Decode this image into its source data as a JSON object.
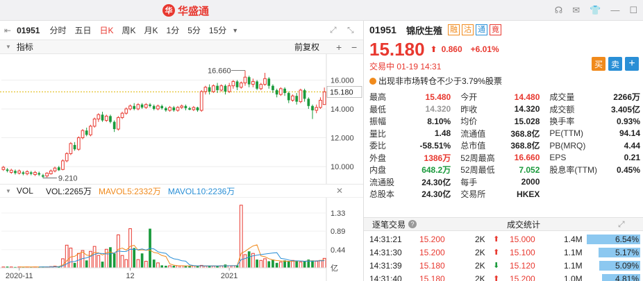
{
  "app": {
    "logo_mark": "华",
    "logo_text": "华盛通",
    "window_icons": [
      "headset-icon",
      "mail-icon",
      "shirt-icon",
      "minimize-icon",
      "maximize-icon"
    ]
  },
  "toolbar": {
    "code": "01951",
    "tabs": [
      "分时",
      "五日",
      "日K",
      "周K",
      "月K",
      "1分",
      "5分",
      "15分"
    ],
    "active_tab": 2
  },
  "indicator_bar": {
    "label": "指标",
    "adjust": "前复权"
  },
  "volume_bar": {
    "label": "VOL",
    "vol": "VOL:2265万",
    "ma5": "MAVOL5:2332万",
    "ma10": "MAVOL10:2236万"
  },
  "colors": {
    "up": "#e8382f",
    "down": "#1a9a3c",
    "ma5": "#f08a1c",
    "ma10": "#2a8fd6",
    "last_line": "#e0b600"
  },
  "chart_data": {
    "type": "candlestick",
    "price_axis": [
      "16.000",
      "14.000",
      "12.000",
      "10.000"
    ],
    "price_ylim": [
      8.9,
      17.7
    ],
    "last_label": "15.180",
    "last_price": 15.18,
    "high_label": "16.660",
    "low_label": "9.210",
    "vol_axis": [
      "1.33",
      "0.89",
      "0.44",
      "亿"
    ],
    "vol_ylim": [
      0,
      1.65
    ],
    "x_labels": [
      "2020-11",
      "12",
      "2021"
    ],
    "x_label_index": [
      4,
      32,
      57
    ],
    "candles": [
      [
        9.8,
        9.95,
        9.7,
        10.05
      ],
      [
        9.8,
        9.7,
        9.6,
        9.9
      ],
      [
        9.6,
        9.75,
        9.5,
        9.85
      ],
      [
        9.7,
        9.55,
        9.45,
        9.8
      ],
      [
        9.55,
        9.7,
        9.45,
        9.8
      ],
      [
        9.6,
        9.5,
        9.4,
        9.7
      ],
      [
        9.5,
        9.65,
        9.4,
        9.75
      ],
      [
        9.6,
        9.5,
        9.4,
        9.7
      ],
      [
        9.45,
        9.6,
        9.35,
        9.7
      ],
      [
        9.55,
        9.45,
        9.35,
        9.65
      ],
      [
        9.4,
        9.3,
        9.21,
        9.5
      ],
      [
        9.35,
        9.55,
        9.25,
        9.6
      ],
      [
        9.5,
        9.7,
        9.45,
        9.8
      ],
      [
        9.7,
        9.9,
        9.6,
        10.0
      ],
      [
        9.95,
        9.75,
        9.7,
        10.05
      ],
      [
        9.8,
        10.4,
        9.75,
        10.5
      ],
      [
        10.4,
        10.9,
        10.3,
        11.0
      ],
      [
        10.9,
        11.6,
        10.8,
        11.7
      ],
      [
        11.5,
        11.2,
        11.1,
        11.7
      ],
      [
        11.2,
        12.0,
        11.1,
        12.1
      ],
      [
        12.0,
        12.5,
        11.9,
        12.6
      ],
      [
        12.5,
        12.2,
        12.1,
        12.7
      ],
      [
        12.2,
        12.8,
        12.1,
        12.9
      ],
      [
        12.8,
        13.3,
        12.7,
        13.4
      ],
      [
        13.3,
        13.6,
        13.1,
        13.7
      ],
      [
        13.6,
        13.2,
        13.1,
        13.8
      ],
      [
        13.2,
        13.5,
        13.1,
        13.6
      ],
      [
        13.5,
        13.1,
        13.0,
        13.6
      ],
      [
        13.1,
        12.6,
        12.4,
        13.2
      ],
      [
        12.6,
        13.4,
        12.5,
        13.5
      ],
      [
        13.4,
        13.7,
        13.3,
        13.8
      ],
      [
        13.7,
        14.0,
        13.6,
        14.1
      ],
      [
        14.0,
        14.2,
        13.9,
        14.3
      ],
      [
        14.2,
        14.0,
        13.9,
        14.4
      ],
      [
        14.0,
        14.3,
        13.9,
        14.4
      ],
      [
        14.3,
        14.1,
        14.0,
        14.4
      ],
      [
        14.1,
        14.3,
        14.0,
        14.4
      ],
      [
        14.3,
        14.2,
        14.1,
        14.4
      ],
      [
        14.2,
        14.0,
        13.9,
        14.3
      ],
      [
        14.0,
        14.2,
        13.9,
        14.3
      ],
      [
        14.2,
        14.05,
        13.95,
        14.3
      ],
      [
        14.05,
        13.9,
        13.8,
        14.15
      ],
      [
        13.9,
        14.1,
        13.8,
        14.2
      ],
      [
        14.1,
        13.9,
        13.8,
        14.2
      ],
      [
        13.9,
        14.1,
        13.8,
        14.2
      ],
      [
        14.1,
        14.2,
        14.0,
        14.3
      ],
      [
        14.2,
        14.05,
        13.9,
        14.3
      ],
      [
        14.05,
        13.95,
        13.9,
        14.15
      ],
      [
        13.95,
        14.1,
        13.85,
        14.2
      ],
      [
        14.1,
        13.9,
        13.8,
        14.15
      ],
      [
        13.9,
        15.2,
        13.8,
        15.3
      ],
      [
        15.2,
        15.5,
        15.0,
        15.6
      ],
      [
        15.5,
        15.2,
        15.0,
        15.7
      ],
      [
        15.2,
        15.6,
        15.1,
        15.7
      ],
      [
        15.6,
        15.3,
        15.1,
        15.8
      ],
      [
        15.3,
        15.6,
        15.2,
        15.7
      ],
      [
        15.6,
        15.2,
        15.0,
        15.7
      ],
      [
        15.2,
        15.6,
        15.1,
        15.8
      ],
      [
        15.6,
        15.9,
        15.4,
        16.0
      ],
      [
        15.9,
        15.5,
        15.3,
        16.0
      ],
      [
        15.5,
        15.8,
        15.4,
        15.9
      ],
      [
        15.8,
        16.2,
        15.6,
        16.66
      ],
      [
        16.2,
        15.7,
        15.5,
        16.3
      ],
      [
        15.7,
        15.9,
        15.5,
        16.1
      ],
      [
        15.9,
        15.4,
        15.3,
        16.0
      ],
      [
        15.4,
        15.7,
        15.3,
        15.8
      ],
      [
        15.7,
        16.1,
        15.6,
        16.5
      ],
      [
        16.1,
        15.6,
        15.4,
        16.2
      ],
      [
        15.6,
        15.3,
        15.1,
        15.7
      ],
      [
        15.3,
        15.0,
        14.8,
        15.4
      ],
      [
        15.0,
        15.4,
        14.9,
        15.5
      ],
      [
        15.4,
        15.1,
        14.9,
        15.5
      ],
      [
        15.1,
        14.6,
        14.4,
        15.2
      ],
      [
        14.6,
        14.9,
        14.5,
        15.0
      ],
      [
        14.9,
        14.5,
        14.3,
        15.1
      ],
      [
        14.5,
        15.3,
        14.4,
        15.4
      ],
      [
        15.3,
        14.7,
        14.5,
        15.4
      ],
      [
        14.7,
        14.2,
        14.0,
        14.8
      ],
      [
        14.2,
        13.9,
        13.3,
        14.3
      ],
      [
        13.9,
        14.1,
        13.7,
        14.3
      ],
      [
        14.1,
        14.6,
        14.0,
        14.8
      ],
      [
        14.3,
        15.18,
        14.32,
        15.48
      ]
    ],
    "volume": [
      0.02,
      0.03,
      0.02,
      0.02,
      0.02,
      0.02,
      0.02,
      0.02,
      0.02,
      0.02,
      0.03,
      0.02,
      0.03,
      0.04,
      0.03,
      0.22,
      0.55,
      0.48,
      0.12,
      0.35,
      0.42,
      0.18,
      0.4,
      0.52,
      0.3,
      0.15,
      0.45,
      0.5,
      0.35,
      0.8,
      0.3,
      0.2,
      0.95,
      0.48,
      0.2,
      0.35,
      0.16,
      0.95,
      0.2,
      0.12,
      0.06,
      0.05,
      0.05,
      0.05,
      0.05,
      0.05,
      0.04,
      0.04,
      0.05,
      0.04,
      0.06,
      0.04,
      0.05,
      0.04,
      0.04,
      0.05,
      0.08,
      0.05,
      0.05,
      0.06,
      1.52,
      0.32,
      0.4,
      0.35,
      0.2,
      0.18,
      0.22,
      0.16,
      0.2,
      0.12,
      0.14,
      0.18,
      0.16,
      0.18,
      0.16,
      0.14,
      0.16,
      0.2,
      0.18,
      0.16,
      0.18,
      0.23
    ]
  },
  "quote": {
    "code": "01951",
    "name": "锦欣生殖",
    "tags": [
      [
        "融",
        "#f08a1c"
      ],
      [
        "沽",
        "#f08a1c"
      ],
      [
        "通",
        "#2a8fd6"
      ],
      [
        "竟",
        "#e8382f"
      ]
    ],
    "price": "15.180",
    "change": "0.860",
    "pct": "+6.01%",
    "status": "交易中 01-19 14:31",
    "notice": "出现非市场转仓不少于3.79%股票",
    "buttons": {
      "buy": "买",
      "sell": "卖",
      "add": "+"
    },
    "rows": [
      [
        [
          "最高",
          "15.480",
          "red"
        ],
        [
          "今开",
          "14.480",
          "red"
        ],
        [
          "成交量",
          "2266万",
          ""
        ]
      ],
      [
        [
          "最低",
          "14.320",
          "gray"
        ],
        [
          "昨收",
          "14.320",
          ""
        ],
        [
          "成交额",
          "3.405亿",
          ""
        ]
      ],
      [
        [
          "振幅",
          "8.10%",
          ""
        ],
        [
          "均价",
          "15.028",
          ""
        ],
        [
          "换手率",
          "0.93%",
          ""
        ]
      ],
      [
        [
          "量比",
          "1.48",
          ""
        ],
        [
          "流通值",
          "368.8亿",
          ""
        ],
        [
          "PE(TTM)",
          "94.14",
          ""
        ]
      ],
      [
        [
          "委比",
          "-58.51%",
          ""
        ],
        [
          "总市值",
          "368.8亿",
          ""
        ],
        [
          "PB(MRQ)",
          "4.44",
          ""
        ]
      ],
      [
        [
          "外盘",
          "1386万",
          "red"
        ],
        [
          "52周最高",
          "16.660",
          "red"
        ],
        [
          "EPS",
          "0.21",
          ""
        ]
      ],
      [
        [
          "内盘",
          "648.2万",
          "green"
        ],
        [
          "52周最低",
          "7.052",
          "green"
        ],
        [
          "股息率(TTM)",
          "0.45%",
          ""
        ]
      ],
      [
        [
          "流通股",
          "24.30亿",
          ""
        ],
        [
          "每手",
          "2000",
          ""
        ],
        [
          "",
          "",
          " "
        ]
      ],
      [
        [
          "总股本",
          "24.30亿",
          ""
        ],
        [
          "交易所",
          "HKEX",
          ""
        ],
        [
          "",
          "",
          " "
        ]
      ]
    ]
  },
  "trades": {
    "title_left": "逐笔交易",
    "title_right": "成交统计",
    "rows": [
      [
        "14:31:21",
        "15.200",
        "2K",
        "up",
        "15.000",
        "1.4M",
        "6.54%",
        0.92
      ],
      [
        "14:31:30",
        "15.200",
        "2K",
        "up",
        "15.100",
        "1.1M",
        "5.17%",
        0.72
      ],
      [
        "14:31:39",
        "15.180",
        "2K",
        "down",
        "15.120",
        "1.1M",
        "5.09%",
        0.7
      ],
      [
        "14:31:40",
        "15.180",
        "2K",
        "up",
        "15.200",
        "1.0M",
        "4.81%",
        0.66
      ]
    ]
  }
}
